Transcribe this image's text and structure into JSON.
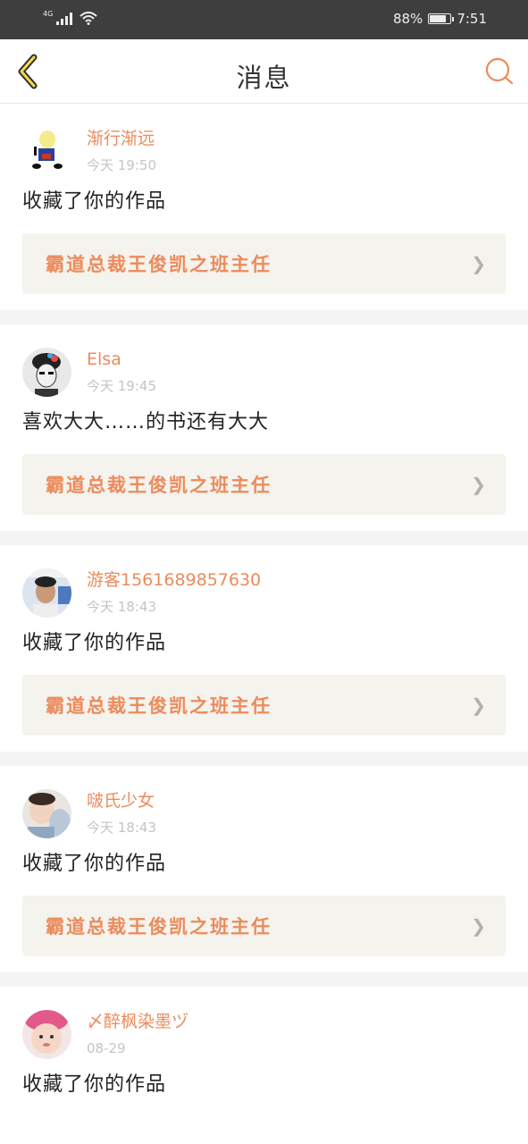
{
  "status_bar": {
    "network": "4G",
    "battery_text": "88%",
    "battery_level": 0.88,
    "time": "7:51"
  },
  "nav": {
    "title": "消息"
  },
  "colors": {
    "accent": "#ec8b5c",
    "card_bg": "#f4f3ed",
    "divider": "#f4f4f4"
  },
  "messages": [
    {
      "username": "渐行渐远",
      "time": "今天 19:50",
      "content": "收藏了你的作品",
      "book": "霸道总裁王俊凯之班主任"
    },
    {
      "username": "Elsa",
      "time": "今天 19:45",
      "content": "喜欢大大……的书还有大大",
      "book": "霸道总裁王俊凯之班主任"
    },
    {
      "username": "游客1561689857630",
      "time": "今天 18:43",
      "content": "收藏了你的作品",
      "book": "霸道总裁王俊凯之班主任"
    },
    {
      "username": "啵氏少女",
      "time": "今天 18:43",
      "content": "收藏了你的作品",
      "book": "霸道总裁王俊凯之班主任"
    },
    {
      "username": "〆醉枫染墨ヅ",
      "time": "08-29",
      "content": "收藏了你的作品"
    }
  ]
}
